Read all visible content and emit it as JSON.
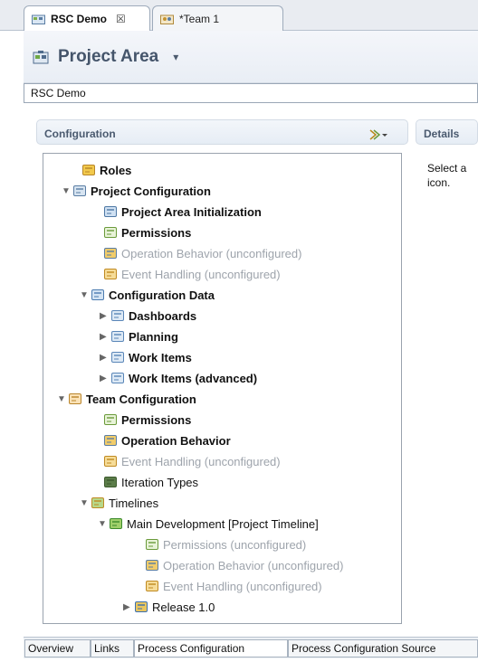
{
  "tabs": [
    {
      "label": "RSC Demo",
      "close": "☒",
      "active": true
    },
    {
      "label": "*Team 1",
      "active": false
    }
  ],
  "header": {
    "title": "Project Area",
    "caret": "▾"
  },
  "name_field": {
    "value": "RSC Demo"
  },
  "sections": {
    "configuration": "Configuration",
    "details": "Details"
  },
  "details_text": {
    "line1": "Select a",
    "line2": "icon."
  },
  "tree": [
    {
      "label": "Roles",
      "style": "bold",
      "arrow": "",
      "icon": "roles-icon"
    },
    {
      "label": "Project Configuration",
      "style": "bold",
      "arrow": "▼",
      "icon": "project-config-icon"
    },
    {
      "label": "Project Area Initialization",
      "style": "bold",
      "arrow": "",
      "icon": "initialization-icon"
    },
    {
      "label": "Permissions",
      "style": "bold",
      "arrow": "",
      "icon": "permissions-icon"
    },
    {
      "label": "Operation Behavior (unconfigured)",
      "style": "gray",
      "arrow": "",
      "icon": "operation-behavior-icon"
    },
    {
      "label": "Event Handling (unconfigured)",
      "style": "gray",
      "arrow": "",
      "icon": "event-handling-icon"
    },
    {
      "label": "Configuration Data",
      "style": "bold",
      "arrow": "▼",
      "icon": "config-data-icon"
    },
    {
      "label": "Dashboards",
      "style": "bold",
      "arrow": "▶",
      "icon": "folder-icon"
    },
    {
      "label": "Planning",
      "style": "bold",
      "arrow": "▶",
      "icon": "folder-icon"
    },
    {
      "label": "Work Items",
      "style": "bold",
      "arrow": "▶",
      "icon": "folder-icon"
    },
    {
      "label": "Work Items (advanced)",
      "style": "bold",
      "arrow": "▶",
      "icon": "folder-icon"
    },
    {
      "label": "Team Configuration",
      "style": "bold",
      "arrow": "▼",
      "icon": "team-config-icon"
    },
    {
      "label": "Permissions",
      "style": "bold",
      "arrow": "",
      "icon": "permissions-icon"
    },
    {
      "label": "Operation Behavior",
      "style": "bold",
      "arrow": "",
      "icon": "operation-behavior-icon"
    },
    {
      "label": "Event Handling (unconfigured)",
      "style": "gray",
      "arrow": "",
      "icon": "event-handling-icon"
    },
    {
      "label": "Iteration Types",
      "style": "norm",
      "arrow": "",
      "icon": "iteration-types-icon"
    },
    {
      "label": "Timelines",
      "style": "norm",
      "arrow": "▼",
      "icon": "timelines-icon"
    },
    {
      "label": "Main Development [Project Timeline]",
      "style": "norm",
      "arrow": "▼",
      "icon": "timeline-icon"
    },
    {
      "label": "Permissions (unconfigured)",
      "style": "gray",
      "arrow": "",
      "icon": "permissions-icon"
    },
    {
      "label": "Operation Behavior (unconfigured)",
      "style": "gray",
      "arrow": "",
      "icon": "operation-behavior-icon"
    },
    {
      "label": "Event Handling (unconfigured)",
      "style": "gray",
      "arrow": "",
      "icon": "event-handling-icon"
    },
    {
      "label": "Release 1.0",
      "style": "norm",
      "arrow": "▶",
      "icon": "release-icon"
    }
  ],
  "bottom_tabs": [
    {
      "label": "Overview"
    },
    {
      "label": "Links"
    },
    {
      "label": "Process Configuration"
    },
    {
      "label": "Process Configuration Source"
    }
  ],
  "colors": {
    "accent": "#45556b",
    "gray_text": "#9ea4ac",
    "tab_border": "#9eabbb"
  }
}
